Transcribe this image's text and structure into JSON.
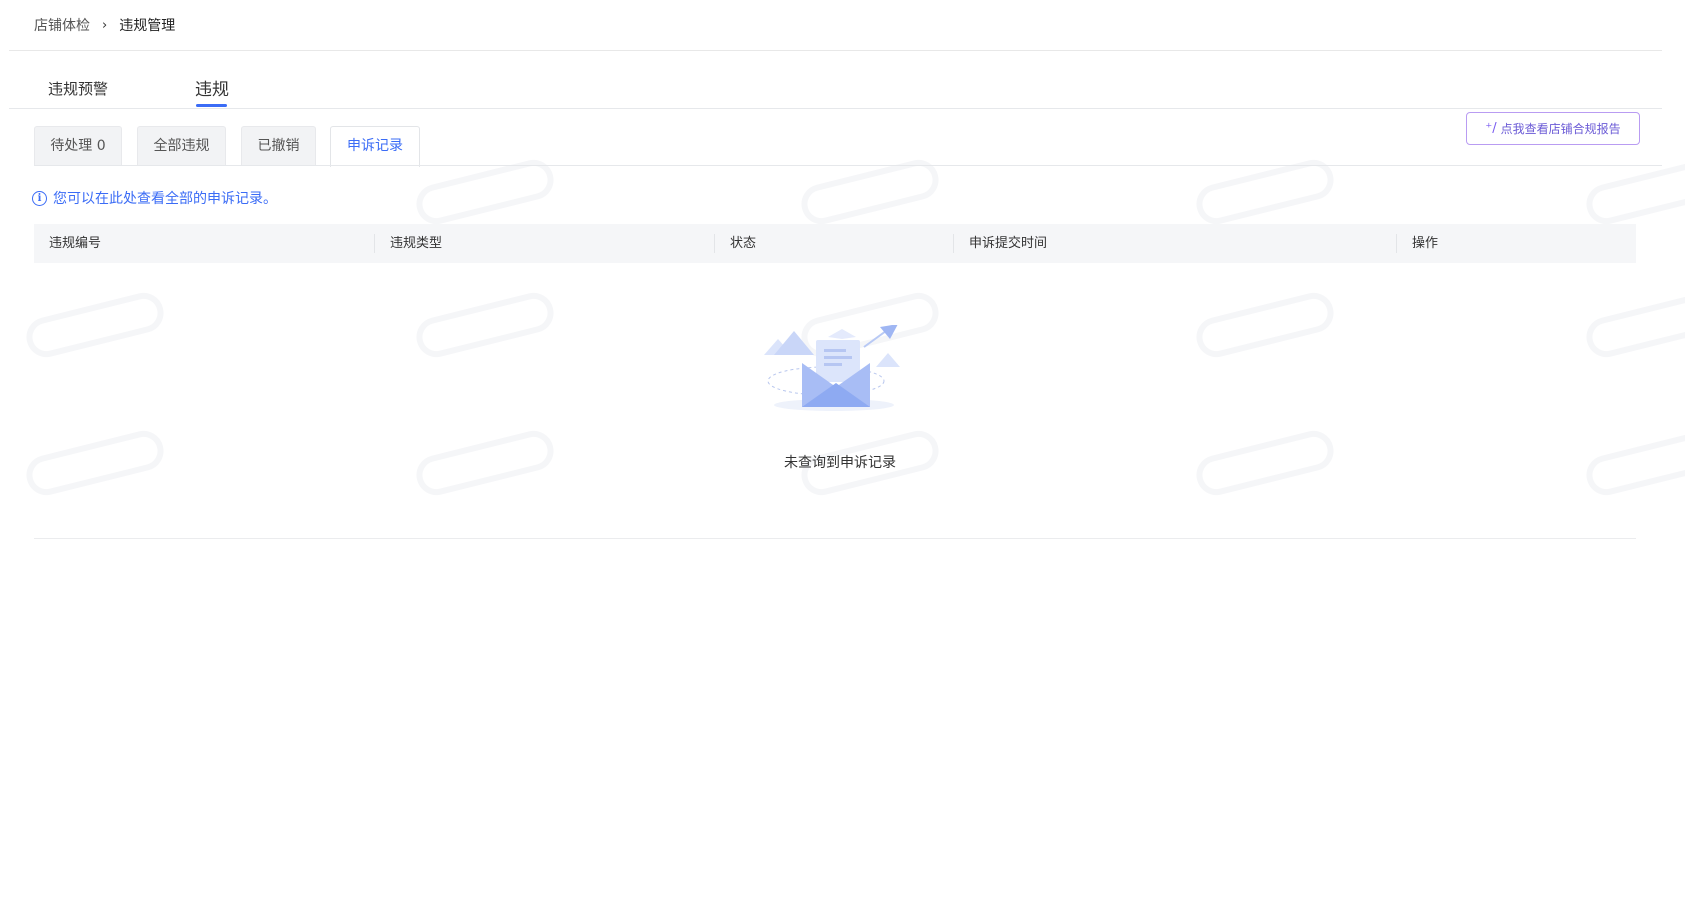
{
  "breadcrumb": {
    "root": "店铺体检",
    "separator": "›",
    "current": "违规管理"
  },
  "primary_tabs": [
    {
      "label": "违规预警",
      "active": false
    },
    {
      "label": "违规",
      "active": true
    }
  ],
  "card_tabs": [
    {
      "label": "待处理 0",
      "active": false
    },
    {
      "label": "全部违规",
      "active": false
    },
    {
      "label": "已撤销",
      "active": false
    },
    {
      "label": "申诉记录",
      "active": true
    }
  ],
  "report_button": {
    "icon": "sparkle-wand-icon",
    "label": "点我查看店铺合规报告"
  },
  "info": {
    "icon": "info-icon",
    "text": "您可以在此处查看全部的申诉记录。"
  },
  "table": {
    "columns": [
      "违规编号",
      "违规类型",
      "状态",
      "申诉提交时间",
      "操作"
    ],
    "rows": []
  },
  "empty_state": {
    "icon": "empty-envelope-icon",
    "text": "未查询到申诉记录"
  },
  "colors": {
    "accent": "#3b6cf6",
    "report_border": "#b99cf2",
    "header_bg": "#f5f6f8"
  }
}
